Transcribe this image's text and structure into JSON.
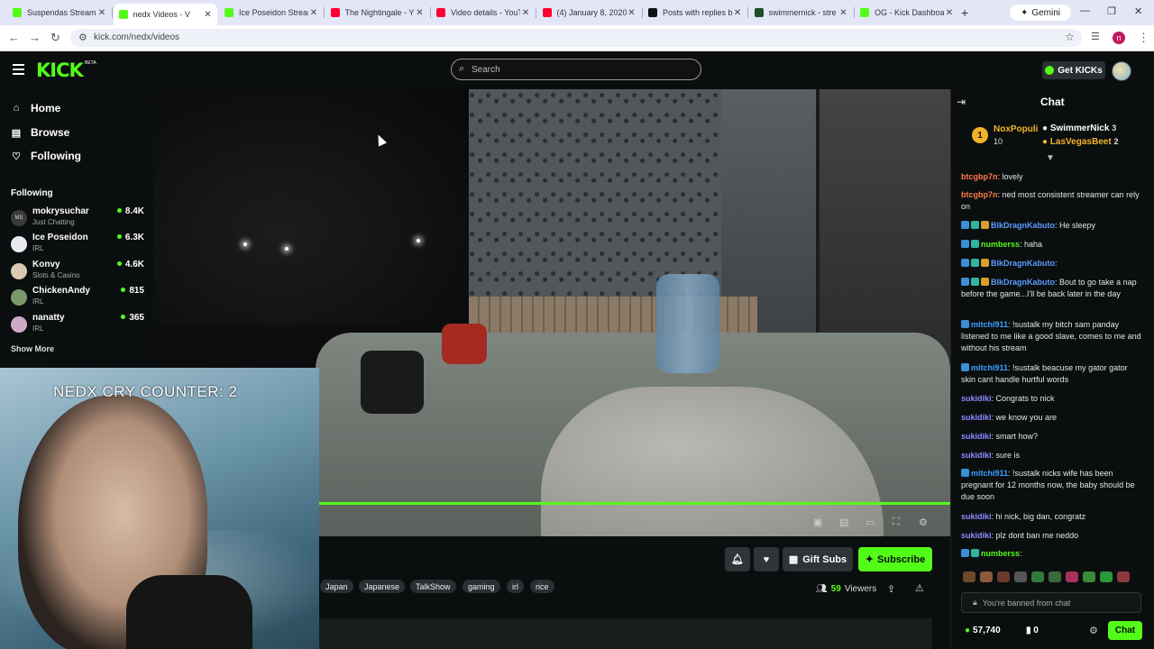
{
  "browser": {
    "tabs": [
      {
        "title": "Suspendas Stream",
        "color": "#53fc18"
      },
      {
        "title": "nedx Videos - V",
        "color": "#53fc18",
        "active": true
      },
      {
        "title": "Ice Poseidon Strean",
        "color": "#53fc18"
      },
      {
        "title": "The Nightingale - Y",
        "color": "#ff0033"
      },
      {
        "title": "Video details - YouT",
        "color": "#ff0033"
      },
      {
        "title": "(4) January 8, 2020",
        "color": "#ff0033"
      },
      {
        "title": "Posts with replies by",
        "color": "#111111"
      },
      {
        "title": "swimmernick - stre",
        "color": "#1f4d2a"
      },
      {
        "title": "OG - Kick Dashboar",
        "color": "#53fc18"
      }
    ],
    "new_tab": "+",
    "gemini_label": "Gemini",
    "url": "kick.com/nedx/videos",
    "profile_initial": "n"
  },
  "header": {
    "logo": "KICK",
    "beta": "BETA",
    "search_placeholder": "Search",
    "get_kicks": "Get KICKs"
  },
  "sidebar": {
    "nav": [
      {
        "label": "Home",
        "icon": "home-icon"
      },
      {
        "label": "Browse",
        "icon": "browse-icon"
      },
      {
        "label": "Following",
        "icon": "heart-icon"
      }
    ],
    "following_heading": "Following",
    "following": [
      {
        "name": "mokrysuchar",
        "category": "Just Chatting",
        "viewers": "8.4K",
        "avatar": "MS"
      },
      {
        "name": "Ice Poseidon",
        "category": "IRL",
        "viewers": "6.3K",
        "avatar": ""
      },
      {
        "name": "Konvy",
        "category": "Slots & Casino",
        "viewers": "4.6K",
        "avatar": ""
      },
      {
        "name": "ChickenAndy",
        "category": "IRL",
        "viewers": "815",
        "avatar": ""
      },
      {
        "name": "nanatty",
        "category": "IRL",
        "viewers": "365",
        "avatar": ""
      }
    ],
    "show_more": "Show More"
  },
  "video": {
    "overlay_text": "NEDX CRY COUNTER: 2",
    "progress_fraction": 1.0
  },
  "channel": {
    "actions": {
      "gift_subs": "Gift Subs",
      "subscribe": "Subscribe"
    },
    "tags": [
      "Japan",
      "Japanese",
      "TalkShow",
      "gaming",
      "irl",
      "rice"
    ],
    "viewers_count": "59",
    "viewers_label": "Viewers"
  },
  "chat": {
    "title": "Chat",
    "leaderboard": {
      "rank": "1",
      "first_name": "NoxPopuli",
      "first_value": "10",
      "others": [
        {
          "name": "SwimmerNick",
          "value": "3"
        },
        {
          "name": "LasVegasBeet",
          "value": "2"
        }
      ]
    },
    "messages": [
      {
        "user": "btcgbp7n",
        "color": "#ff7a45",
        "text": "lovely",
        "badges": 0
      },
      {
        "user": "btcgbp7n",
        "color": "#ff7a45",
        "text": "ned most consistent streamer can rely on",
        "badges": 0
      },
      {
        "user": "BlkDragnKabuto",
        "color": "#5b9cff",
        "text": "He sleepy",
        "badges": 3
      },
      {
        "user": "numberss",
        "color": "#53fc18",
        "text": "haha",
        "badges": 2
      },
      {
        "user": "BlkDragnKabuto",
        "color": "#5b9cff",
        "text": "",
        "badges": 3
      },
      {
        "user": "BlkDragnKabuto",
        "color": "#5b9cff",
        "text": "Bout to go take a nap before the game...I'll be back later in the day",
        "badges": 3
      },
      {
        "user": "mitchi911",
        "color": "#3aa0ff",
        "text": "!sustalk my bitch sam panday listened to me like a good slave, comes to me and without his stream",
        "badges": 1
      },
      {
        "user": "mitchi911",
        "color": "#3aa0ff",
        "text": "!sustalk beacuse my gator gator skin cant handle hurtful words",
        "badges": 1
      },
      {
        "user": "sukidiki",
        "color": "#8b8bff",
        "text": "Congrats to nick",
        "badges": 0
      },
      {
        "user": "sukidiki",
        "color": "#8b8bff",
        "text": "we know you are",
        "badges": 0
      },
      {
        "user": "sukidiki",
        "color": "#8b8bff",
        "text": "smart how?",
        "badges": 0
      },
      {
        "user": "sukidiki",
        "color": "#8b8bff",
        "text": "sure is",
        "badges": 0
      },
      {
        "user": "mitchi911",
        "color": "#3aa0ff",
        "text": "!sustalk nicks wife has been pregnant for 12 months now, the baby should be due soon",
        "badges": 1
      },
      {
        "user": "sukidiki",
        "color": "#8b8bff",
        "text": "hi nick, big dan, congratz",
        "badges": 0
      },
      {
        "user": "sukidiki",
        "color": "#8b8bff",
        "text": "plz dont ban me neddo",
        "badges": 0
      },
      {
        "user": "numberss",
        "color": "#53fc18",
        "text": "",
        "badges": 2
      }
    ],
    "banned_text": "You're banned from chat",
    "kicks_balance": "57,740",
    "other_count": "0",
    "chat_button": "Chat"
  }
}
